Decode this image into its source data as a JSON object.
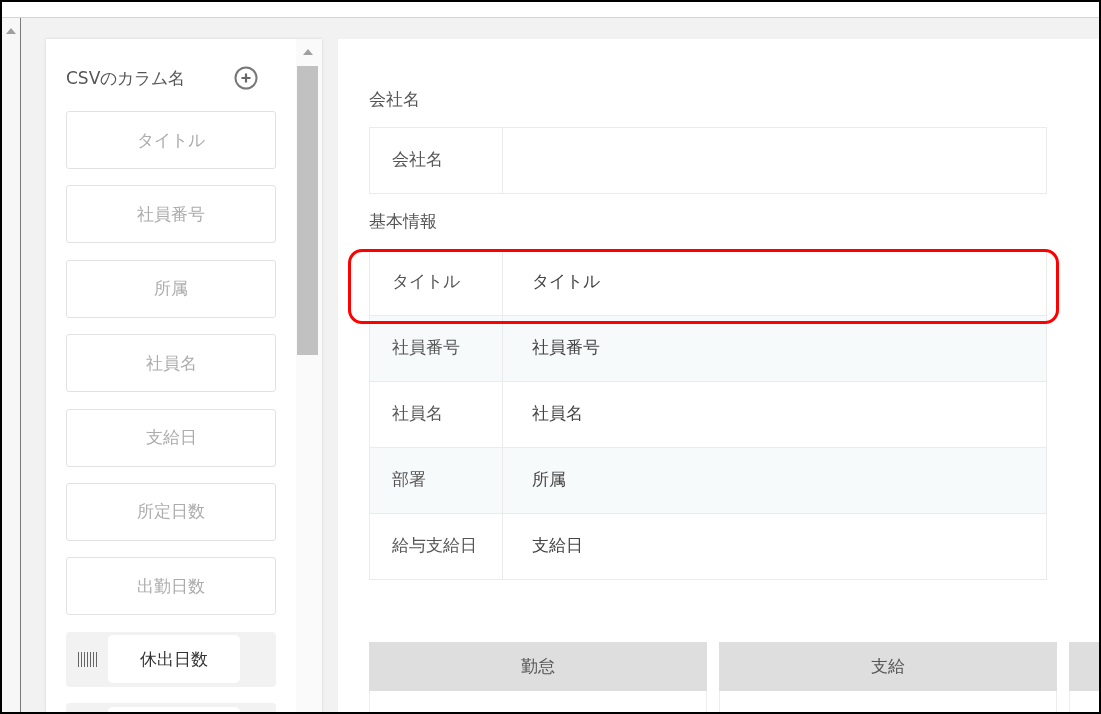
{
  "csv_panel": {
    "title": "CSVのカラム名",
    "columns": [
      {
        "label": "タイトル",
        "mapped": true
      },
      {
        "label": "社員番号",
        "mapped": true
      },
      {
        "label": "所属",
        "mapped": true
      },
      {
        "label": "社員名",
        "mapped": true
      },
      {
        "label": "支給日",
        "mapped": true
      },
      {
        "label": "所定日数",
        "mapped": true
      },
      {
        "label": "出勤日数",
        "mapped": true
      },
      {
        "label": "休出日数",
        "mapped": false
      },
      {
        "mapped": false
      }
    ]
  },
  "company_section": {
    "heading": "会社名",
    "rows": [
      {
        "label": "会社名",
        "highlighted": false
      }
    ]
  },
  "basic_info": {
    "heading": "基本情報",
    "rows": [
      {
        "label": "タイトル",
        "value": "タイトル",
        "highlighted": true
      },
      {
        "label": "社員番号",
        "value": "社員番号",
        "highlighted": false
      },
      {
        "label": "社員名",
        "value": "社員名",
        "highlighted": false
      },
      {
        "label": "部署",
        "value": "所属",
        "highlighted": false
      },
      {
        "label": "給与支給日",
        "value": "支給日",
        "highlighted": false
      }
    ]
  },
  "categories": [
    {
      "kind": "full",
      "label": "勤怠"
    },
    {
      "kind": "full",
      "label": "支給"
    },
    {
      "kind": "partial"
    }
  ]
}
